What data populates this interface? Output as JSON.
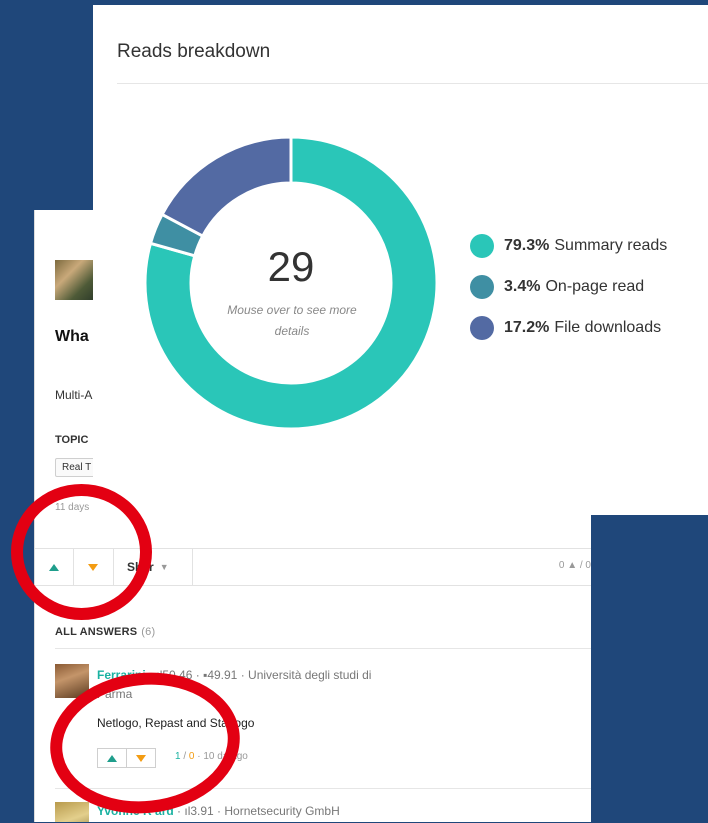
{
  "question": {
    "title_fragment": "Wha syst",
    "subtitle_fragment": "Multi-A",
    "topics_label": "TOPIC",
    "topic_chip": "Real T",
    "age_fragment": "11 days"
  },
  "toolbar": {
    "share_label": "Shar",
    "vote_count": "0 ▲ / 0"
  },
  "answers": {
    "header": "ALL ANSWERS",
    "count": "(6)",
    "items": [
      {
        "name": "Ferrarini",
        "score1": "50.46",
        "score2": "49.91",
        "affiliation": "Università degli studi di",
        "affiliation_cont": "Parma",
        "text": "Netlogo, Repast and Starlogo",
        "up": "1",
        "down": "0",
        "age": "10 da   ago"
      },
      {
        "name": "Yvonne R  ard",
        "score1": "3.91",
        "affiliation": "Hornetsecurity GmbH"
      }
    ]
  },
  "reads_card": {
    "title": "Reads breakdown",
    "total": "29",
    "hint": "Mouse over to see more details"
  },
  "chart_data": {
    "type": "pie",
    "style": "donut",
    "title": "Reads breakdown",
    "total": 29,
    "series": [
      {
        "name": "Summary reads",
        "percent": 79.3,
        "label": "79.3%",
        "color": "#2ac6b8"
      },
      {
        "name": "On-page read",
        "percent": 3.4,
        "label": "3.4%",
        "color": "#3f8fa3"
      },
      {
        "name": "File downloads",
        "percent": 17.2,
        "label": "17.2%",
        "color": "#536aa3"
      }
    ],
    "legend_position": "right"
  },
  "colors": {
    "page_background": "#1f477a",
    "accent_green": "#1ab2a1",
    "accent_orange": "#f39c12",
    "annotation_red": "#e30012"
  }
}
